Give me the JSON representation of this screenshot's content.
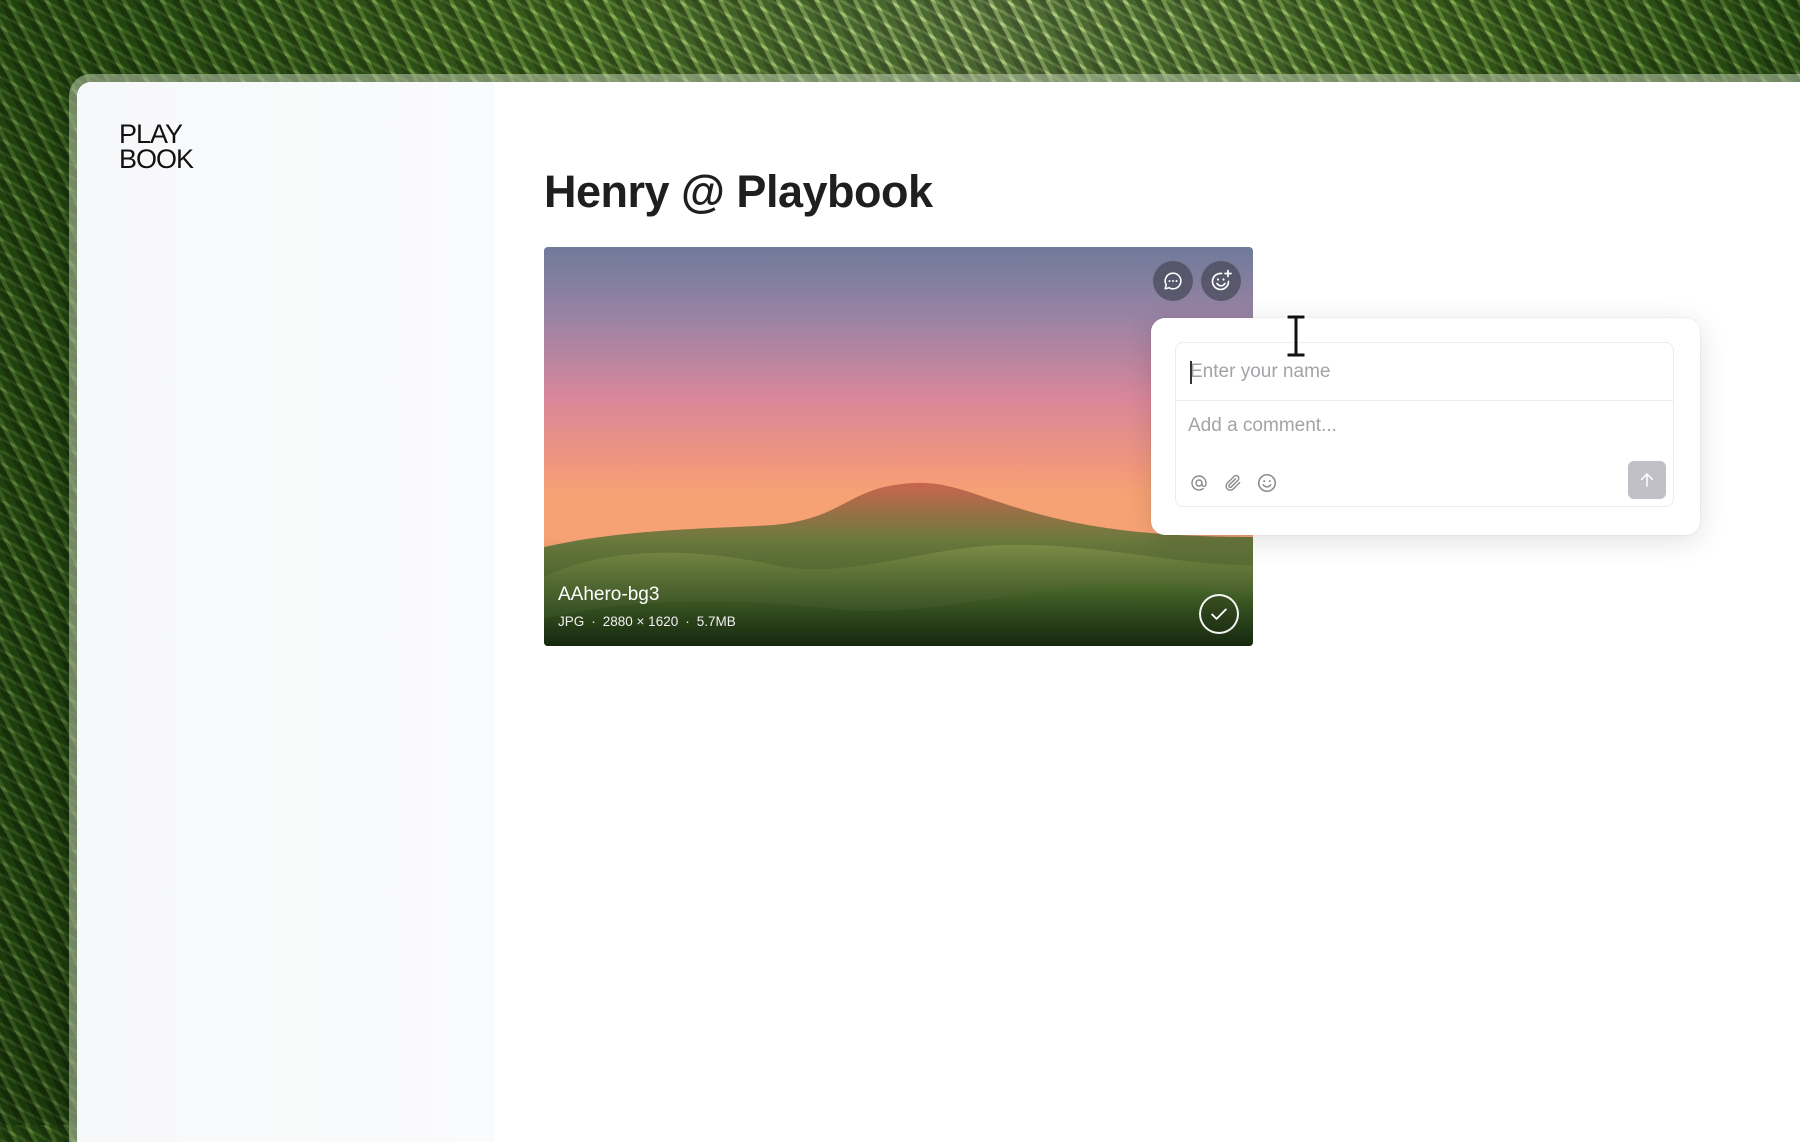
{
  "logo": {
    "line1": "PLAY",
    "line2": "BOOK"
  },
  "page": {
    "title": "Henry @ Playbook"
  },
  "asset": {
    "name": "AAhero-bg3",
    "type": "JPG",
    "dimensions": "2880 × 1620",
    "size": "5.7MB",
    "separator": "·"
  },
  "card_actions": [
    {
      "icon": "comment-icon"
    },
    {
      "icon": "add-reaction-icon"
    }
  ],
  "comment_form": {
    "name_placeholder": "Enter your name",
    "comment_placeholder": "Add a comment...",
    "tools": [
      "mention-icon",
      "attachment-icon",
      "emoji-icon"
    ],
    "send_icon": "arrow-up-icon"
  },
  "colors": {
    "title": "#1f1f1f",
    "send_disabled": "#c0c0c6",
    "placeholder": "#a3a3a8"
  }
}
